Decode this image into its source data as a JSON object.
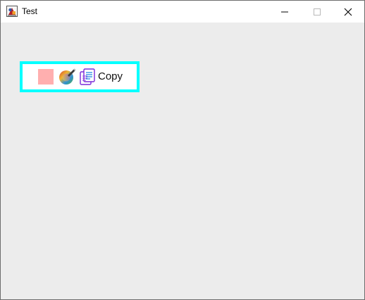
{
  "window": {
    "title": "Test",
    "app_icon": "java-icon",
    "controls": {
      "minimize": "minimize-icon",
      "maximize": "maximize-icon",
      "close": "close-icon"
    }
  },
  "toolbar": {
    "color_swatch": "#FFAFAF",
    "color_picker_icon": "color-wheel-icon",
    "copy_icon": "copy-icon",
    "copy_label": "Copy",
    "highlight_color": "#00FFFF"
  }
}
